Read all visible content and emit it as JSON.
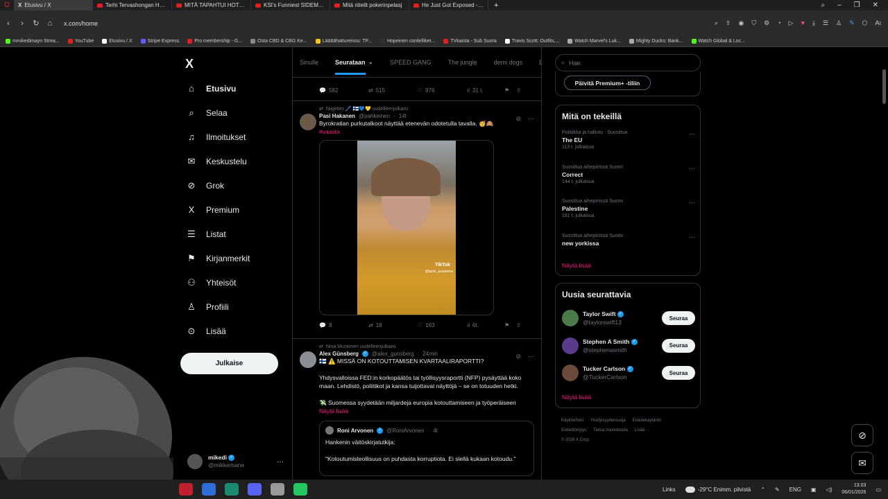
{
  "browser": {
    "tabs": [
      {
        "title": "Etusivu / X",
        "kind": "x",
        "active": true
      },
      {
        "title": "Terhi Tervashongan Haast",
        "kind": "youtube"
      },
      {
        "title": "MITÄ TAPAHTUI HOTELLIIN",
        "kind": "youtube"
      },
      {
        "title": "KSI's Funniest SIDEMEN M",
        "kind": "youtube"
      },
      {
        "title": "Mitä riitelit pokerinpelasj",
        "kind": "youtube"
      },
      {
        "title": "He Just Got Exposed - You",
        "kind": "youtube"
      }
    ],
    "url": "x.com/home",
    "bookmarks": [
      {
        "label": "mmikedimayn Strea...",
        "color": "#53fc18"
      },
      {
        "label": "YouTube",
        "color": "#e02020"
      },
      {
        "label": "Etusivu / X",
        "color": "#ffffff"
      },
      {
        "label": "Stripe Express",
        "color": "#635bff"
      },
      {
        "label": "Pro membership - G...",
        "color": "#e02020"
      },
      {
        "label": "Osta CBD & CBG Ke...",
        "color": "#888888"
      },
      {
        "label": "Läättähattureissu: TP...",
        "color": "#f5c518"
      },
      {
        "label": "Hopeinen cordelliket...",
        "color": "#333333"
      },
      {
        "label": "TVkaista - Sub Suora",
        "color": "#e02020"
      },
      {
        "label": "Travis Scott: Outfits,...",
        "color": "#ffffff"
      },
      {
        "label": "Watch Marvel's Luk...",
        "color": "#aaaaaa"
      },
      {
        "label": "Mighty Ducks: Bank...",
        "color": "#aaaaaa"
      },
      {
        "label": "Watch Global & Loc...",
        "color": "#53fc18"
      }
    ]
  },
  "nav": {
    "logo": "X",
    "items": [
      {
        "label": "Etusivu",
        "icon": "home-icon",
        "glyph": "⌂",
        "bold": true
      },
      {
        "label": "Selaa",
        "icon": "search-icon",
        "glyph": "⌕"
      },
      {
        "label": "Ilmoitukset",
        "icon": "bell-icon",
        "glyph": "♫"
      },
      {
        "label": "Keskustelu",
        "icon": "mail-icon",
        "glyph": "✉"
      },
      {
        "label": "Grok",
        "icon": "grok-icon",
        "glyph": "⊘"
      },
      {
        "label": "Premium",
        "icon": "x-logo-icon",
        "glyph": "X"
      },
      {
        "label": "Listat",
        "icon": "list-icon",
        "glyph": "☰"
      },
      {
        "label": "Kirjanmerkit",
        "icon": "bookmark-icon",
        "glyph": "⚑"
      },
      {
        "label": "Yhteisöt",
        "icon": "communities-icon",
        "glyph": "⚇"
      },
      {
        "label": "Profiili",
        "icon": "profile-icon",
        "glyph": "♙"
      },
      {
        "label": "Lisää",
        "icon": "more-circle-icon",
        "glyph": "⊙"
      }
    ],
    "post_button": "Julkaise",
    "account": {
      "name": "mikedi",
      "handle": "@mikkemane"
    }
  },
  "feed": {
    "tabs": [
      "Sinulle",
      "Seurataan",
      "SPEED GANG",
      "The jungle",
      "demi dogs",
      "Dima"
    ],
    "active_tab": "Seurataan",
    "top_actions": {
      "replies": "582",
      "reposts": "515",
      "likes": "976",
      "views": "31 t."
    },
    "post1": {
      "repost_by": "Niigebro 🖊️ 🇫🇮💙💛 uudelleenjulkaisi",
      "name": "Pasi Hakanen",
      "handle": "@pahkeinen",
      "time": "14t",
      "text": "Byrokratian purkutalkoot näyttää etenevän odotetulla tavalla. 🥳🙈",
      "hashtag": "#vaasta",
      "video_watermark": "TikTok",
      "video_handle": "@tanhi_assamma",
      "replies": "8",
      "reposts": "18",
      "likes": "163",
      "views": "6t."
    },
    "post2": {
      "repost_by": "Nina Mustonen uudelleenjulkaisi",
      "name": "Alex Günsberg",
      "handle": "@alex_gunsberg",
      "time": "24min",
      "line1": "🇫🇮 ⚠️ MISSÄ ON KOTOUTTAMISEN KVARTAALIRAPORTTI?",
      "para1": "Yhdysvalloissa FED:in korkopäätös tai työllisyysraportti (NFP) pysäyttää koko maan. Lehdistö, poliitikot ja kansa tuijottavat näyttöjä – se on totuuden hetki.",
      "para2": "💸 Suomessa syydetään miljardeja europia kotouttamiseen ja työperäiseen",
      "show_more": "Näytä lisää",
      "quote": {
        "name": "Roni Arvonen",
        "handle": "@RoniArvonen",
        "time": "4t",
        "line1": "Hankenin väitöskirjatutkija:",
        "line2": "\"Kotoutumisteollisuus on puhdasta korruptiota. Ei siellä kukaan kotoudu.\""
      }
    }
  },
  "right": {
    "search_placeholder": "Hae",
    "premium_button": "Päivitä Premium+ -tiliin",
    "trends_title": "Mitä on tekeillä",
    "trends": [
      {
        "context": "Politiikka ja hallinto · Suosittua",
        "name": "The EU",
        "count": "113 t. julkaisua"
      },
      {
        "context": "Suosittua aihepiirissä Suomi",
        "name": "Correct",
        "count": "144 t. julkaisua"
      },
      {
        "context": "Suosittua aihepiirissä Suomi",
        "name": "Palestine",
        "count": "181 t. julkaisua"
      },
      {
        "context": "Suosittua aihepiirissä Suomi",
        "name": "new yorkissa",
        "count": ""
      }
    ],
    "show_more": "Näytä lisää",
    "who_title": "Uusia seurattavia",
    "who": [
      {
        "name": "Taylor Swift",
        "handle": "@taylorswift13",
        "color": "#4a7a4a"
      },
      {
        "name": "Stephen A Smith",
        "handle": "@stephenasmith",
        "color": "#5a3a8a"
      },
      {
        "name": "Tucker Carlson",
        "handle": "@TuckerCarlson",
        "color": "#6a4a3a"
      }
    ],
    "follow_label": "Seuraa",
    "footer": [
      "Käyttöehdot",
      "Yksityisyydensuoja",
      "Evästekäytäntö",
      "Esteettömyys",
      "Tietoa mainoksista",
      "Lisää ···",
      "© 2026 X Corp."
    ]
  },
  "taskbar": {
    "links": "Links",
    "weather": "-29°C  Enimm. pilvistä",
    "lang": "ENG",
    "time": "13.03",
    "date": "06/01/2026"
  }
}
